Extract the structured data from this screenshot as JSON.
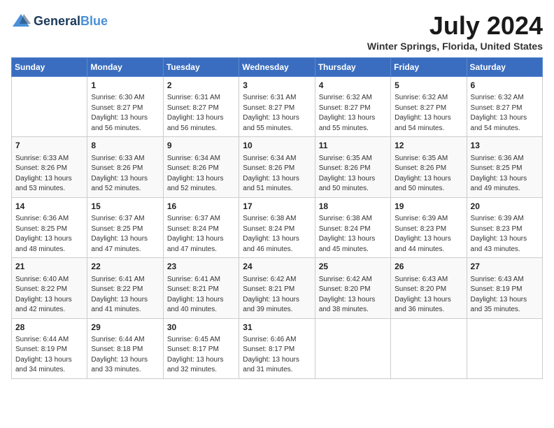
{
  "header": {
    "logo_general": "General",
    "logo_blue": "Blue",
    "title": "July 2024",
    "location": "Winter Springs, Florida, United States"
  },
  "days_of_week": [
    "Sunday",
    "Monday",
    "Tuesday",
    "Wednesday",
    "Thursday",
    "Friday",
    "Saturday"
  ],
  "weeks": [
    [
      {
        "day": "",
        "info": ""
      },
      {
        "day": "1",
        "info": "Sunrise: 6:30 AM\nSunset: 8:27 PM\nDaylight: 13 hours\nand 56 minutes."
      },
      {
        "day": "2",
        "info": "Sunrise: 6:31 AM\nSunset: 8:27 PM\nDaylight: 13 hours\nand 56 minutes."
      },
      {
        "day": "3",
        "info": "Sunrise: 6:31 AM\nSunset: 8:27 PM\nDaylight: 13 hours\nand 55 minutes."
      },
      {
        "day": "4",
        "info": "Sunrise: 6:32 AM\nSunset: 8:27 PM\nDaylight: 13 hours\nand 55 minutes."
      },
      {
        "day": "5",
        "info": "Sunrise: 6:32 AM\nSunset: 8:27 PM\nDaylight: 13 hours\nand 54 minutes."
      },
      {
        "day": "6",
        "info": "Sunrise: 6:32 AM\nSunset: 8:27 PM\nDaylight: 13 hours\nand 54 minutes."
      }
    ],
    [
      {
        "day": "7",
        "info": "Sunrise: 6:33 AM\nSunset: 8:26 PM\nDaylight: 13 hours\nand 53 minutes."
      },
      {
        "day": "8",
        "info": "Sunrise: 6:33 AM\nSunset: 8:26 PM\nDaylight: 13 hours\nand 52 minutes."
      },
      {
        "day": "9",
        "info": "Sunrise: 6:34 AM\nSunset: 8:26 PM\nDaylight: 13 hours\nand 52 minutes."
      },
      {
        "day": "10",
        "info": "Sunrise: 6:34 AM\nSunset: 8:26 PM\nDaylight: 13 hours\nand 51 minutes."
      },
      {
        "day": "11",
        "info": "Sunrise: 6:35 AM\nSunset: 8:26 PM\nDaylight: 13 hours\nand 50 minutes."
      },
      {
        "day": "12",
        "info": "Sunrise: 6:35 AM\nSunset: 8:26 PM\nDaylight: 13 hours\nand 50 minutes."
      },
      {
        "day": "13",
        "info": "Sunrise: 6:36 AM\nSunset: 8:25 PM\nDaylight: 13 hours\nand 49 minutes."
      }
    ],
    [
      {
        "day": "14",
        "info": "Sunrise: 6:36 AM\nSunset: 8:25 PM\nDaylight: 13 hours\nand 48 minutes."
      },
      {
        "day": "15",
        "info": "Sunrise: 6:37 AM\nSunset: 8:25 PM\nDaylight: 13 hours\nand 47 minutes."
      },
      {
        "day": "16",
        "info": "Sunrise: 6:37 AM\nSunset: 8:24 PM\nDaylight: 13 hours\nand 47 minutes."
      },
      {
        "day": "17",
        "info": "Sunrise: 6:38 AM\nSunset: 8:24 PM\nDaylight: 13 hours\nand 46 minutes."
      },
      {
        "day": "18",
        "info": "Sunrise: 6:38 AM\nSunset: 8:24 PM\nDaylight: 13 hours\nand 45 minutes."
      },
      {
        "day": "19",
        "info": "Sunrise: 6:39 AM\nSunset: 8:23 PM\nDaylight: 13 hours\nand 44 minutes."
      },
      {
        "day": "20",
        "info": "Sunrise: 6:39 AM\nSunset: 8:23 PM\nDaylight: 13 hours\nand 43 minutes."
      }
    ],
    [
      {
        "day": "21",
        "info": "Sunrise: 6:40 AM\nSunset: 8:22 PM\nDaylight: 13 hours\nand 42 minutes."
      },
      {
        "day": "22",
        "info": "Sunrise: 6:41 AM\nSunset: 8:22 PM\nDaylight: 13 hours\nand 41 minutes."
      },
      {
        "day": "23",
        "info": "Sunrise: 6:41 AM\nSunset: 8:21 PM\nDaylight: 13 hours\nand 40 minutes."
      },
      {
        "day": "24",
        "info": "Sunrise: 6:42 AM\nSunset: 8:21 PM\nDaylight: 13 hours\nand 39 minutes."
      },
      {
        "day": "25",
        "info": "Sunrise: 6:42 AM\nSunset: 8:20 PM\nDaylight: 13 hours\nand 38 minutes."
      },
      {
        "day": "26",
        "info": "Sunrise: 6:43 AM\nSunset: 8:20 PM\nDaylight: 13 hours\nand 36 minutes."
      },
      {
        "day": "27",
        "info": "Sunrise: 6:43 AM\nSunset: 8:19 PM\nDaylight: 13 hours\nand 35 minutes."
      }
    ],
    [
      {
        "day": "28",
        "info": "Sunrise: 6:44 AM\nSunset: 8:19 PM\nDaylight: 13 hours\nand 34 minutes."
      },
      {
        "day": "29",
        "info": "Sunrise: 6:44 AM\nSunset: 8:18 PM\nDaylight: 13 hours\nand 33 minutes."
      },
      {
        "day": "30",
        "info": "Sunrise: 6:45 AM\nSunset: 8:17 PM\nDaylight: 13 hours\nand 32 minutes."
      },
      {
        "day": "31",
        "info": "Sunrise: 6:46 AM\nSunset: 8:17 PM\nDaylight: 13 hours\nand 31 minutes."
      },
      {
        "day": "",
        "info": ""
      },
      {
        "day": "",
        "info": ""
      },
      {
        "day": "",
        "info": ""
      }
    ]
  ]
}
